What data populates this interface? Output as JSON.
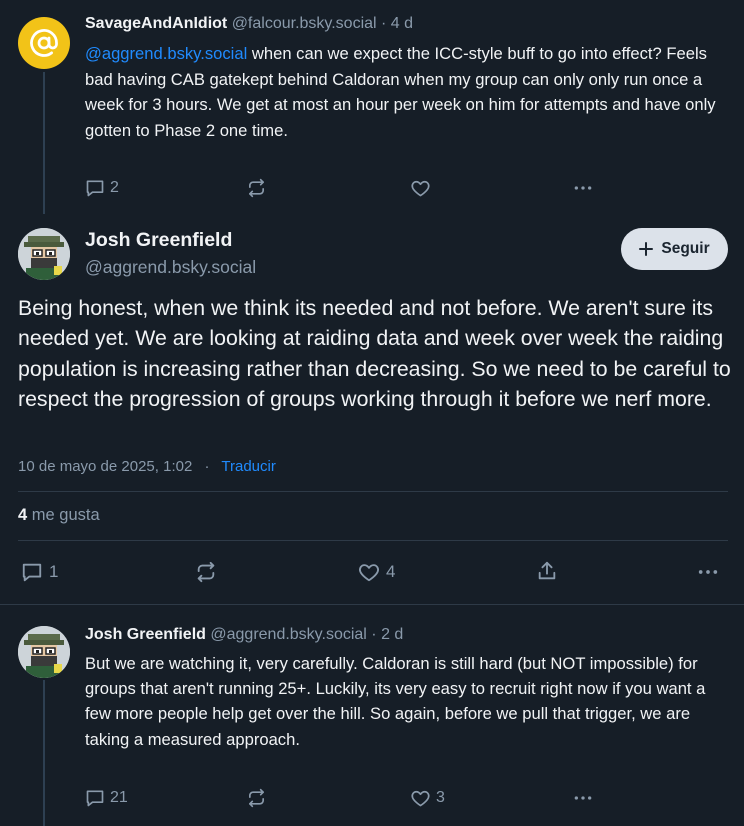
{
  "parent_post": {
    "author": "SavageAndAnIdiot",
    "handle": "@falcour.bsky.social",
    "time": "· 4 d",
    "mention": "@aggrend.bsky.social",
    "text": " when can we expect the ICC-style buff to go into effect? Feels bad having CAB gatekept behind Caldoran when my group can only only run once a week for 3 hours.  We get at most an hour per week on him for attempts and have only gotten to Phase 2 one time.",
    "replies": "2"
  },
  "main_post": {
    "author": "Josh Greenfield",
    "handle": "@aggrend.bsky.social",
    "follow_label": "Seguir",
    "text": "Being honest, when we think its needed and not before. We aren't sure its needed yet. We are looking at raiding data and week over week the raiding population is increasing rather than decreasing. So we need to be careful to respect the progression of groups working through it before we nerf more.",
    "date": "10 de mayo de 2025, 1:02",
    "separator": "·",
    "translate_label": "Traducir",
    "likes_count": "4",
    "likes_label": "me gusta",
    "replies": "1",
    "likes": "4"
  },
  "reply_post": {
    "author": "Josh Greenfield",
    "handle": "@aggrend.bsky.social",
    "time": "· 2 d",
    "text": "But we are watching it, very carefully. Caldoran is still  hard (but NOT impossible) for groups that aren't running 25+. Luckily, its very easy to recruit right now if you want a few more people help get over the hill. So again, before we pull that trigger, we are taking a measured approach.",
    "replies": "21",
    "likes": "3"
  },
  "colors": {
    "background": "#161e27",
    "accent": "#208bfe",
    "muted": "#8a9aab",
    "avatar_yellow": "#f2c318"
  }
}
